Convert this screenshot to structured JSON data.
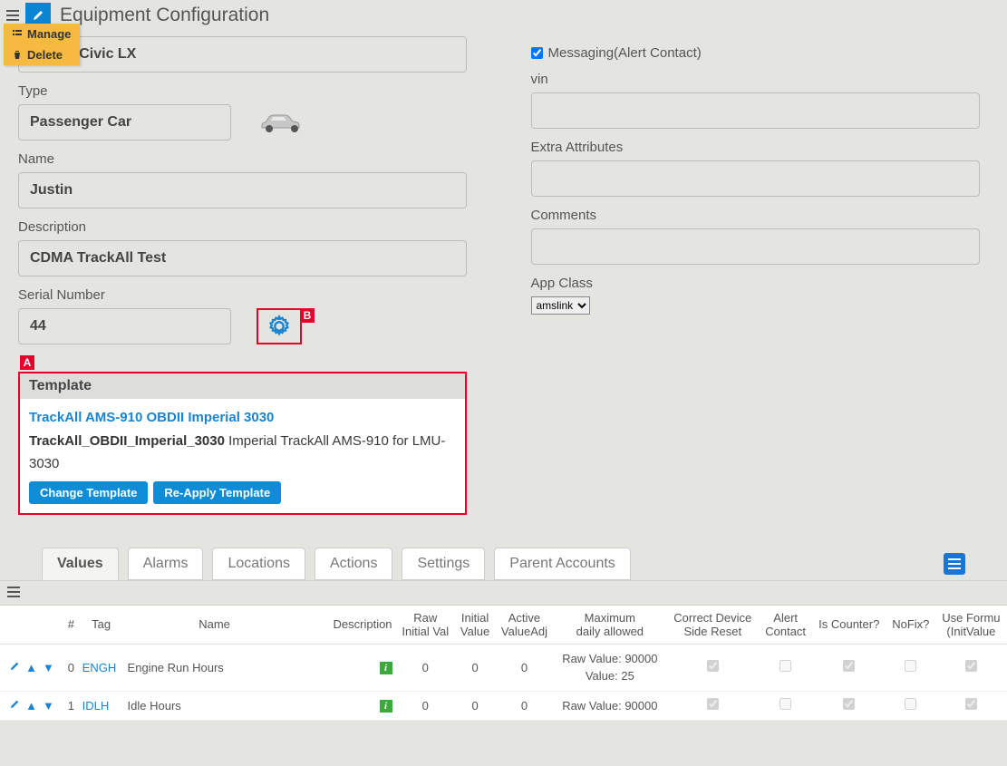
{
  "page": {
    "title": "Equipment Configuration"
  },
  "menu": {
    "manage": "Manage",
    "delete": "Delete"
  },
  "callouts": {
    "a": "A",
    "b": "B"
  },
  "left": {
    "title_field": {
      "value": "Honda Civic LX"
    },
    "type": {
      "label": "Type",
      "value": "Passenger Car"
    },
    "name": {
      "label": "Name",
      "value": "Justin"
    },
    "desc": {
      "label": "Description",
      "value": "CDMA TrackAll Test"
    },
    "serial": {
      "label": "Serial Number",
      "value": "44"
    }
  },
  "template": {
    "header": "Template",
    "link": "TrackAll AMS-910 OBDII Imperial 3030",
    "code": "TrackAll_OBDII_Imperial_3030",
    "after": " Imperial TrackAll AMS-910 for LMU-3030",
    "change": "Change Template",
    "reapply": "Re-Apply Template"
  },
  "right": {
    "messaging": {
      "label": "Messaging(Alert Contact)",
      "checked": true
    },
    "vin": {
      "label": "vin",
      "value": ""
    },
    "extra": {
      "label": "Extra Attributes",
      "value": ""
    },
    "comments": {
      "label": "Comments",
      "value": ""
    },
    "appclass": {
      "label": "App Class",
      "value": "amslink"
    }
  },
  "tabs": {
    "values": "Values",
    "alarms": "Alarms",
    "locations": "Locations",
    "actions": "Actions",
    "settings": "Settings",
    "parent": "Parent Accounts"
  },
  "grid": {
    "headers": {
      "num": "#",
      "tag": "Tag",
      "name": "Name",
      "desc": "Description",
      "rawinit": "Raw Initial Val",
      "initval": "Initial Value",
      "active": "Active ValueAdj",
      "max": "Maximum daily allowed",
      "correct": "Correct Device Side Reset",
      "alert": "Alert Contact",
      "iscounter": "Is Counter?",
      "nofix": "NoFix?",
      "useform": "Use Formula (InitValue)"
    },
    "rows": [
      {
        "num": "0",
        "tag": "ENGH",
        "name": "Engine Run Hours",
        "raw": "0",
        "init": "0",
        "active": "0",
        "max_raw": "Raw Value: 90000",
        "max_val": "Value: 25",
        "correct": true,
        "alert": false,
        "iscounter": true,
        "nofix": false,
        "useform": true
      },
      {
        "num": "1",
        "tag": "IDLH",
        "name": "Idle Hours",
        "raw": "0",
        "init": "0",
        "active": "0",
        "max_raw": "Raw Value: 90000",
        "max_val": "",
        "correct": true,
        "alert": false,
        "iscounter": true,
        "nofix": false,
        "useform": true
      }
    ]
  }
}
